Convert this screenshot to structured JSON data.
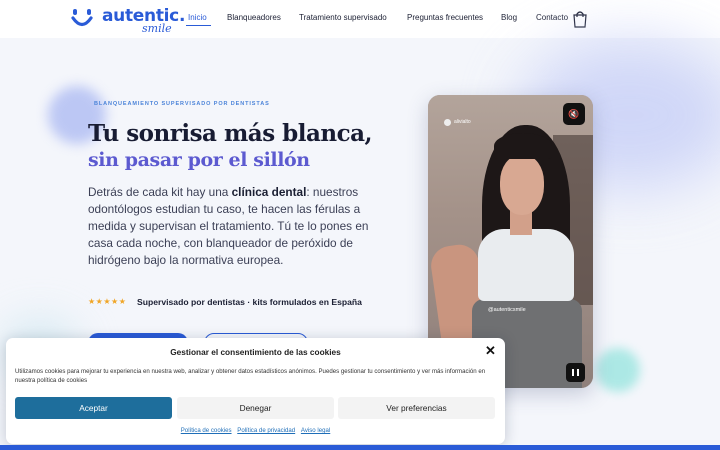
{
  "brand": {
    "name": "autentic.",
    "sub": "smile",
    "color": "#2a5bd7"
  },
  "nav": {
    "items": [
      "Inicio",
      "Blanqueadores",
      "Tratamiento supervisado",
      "Preguntas frecuentes",
      "Blog",
      "Contacto"
    ],
    "active": "Inicio",
    "cart_icon": "shopping-bag-icon"
  },
  "hero": {
    "eyebrow": "BLANQUEAMIENTO SUPERVISADO POR DENTISTAS",
    "title_line1": "Tu sonrisa más blanca,",
    "title_line2": "sin pasar por el sillón",
    "body_before": "Detrás de cada kit hay una ",
    "body_bold": "clínica dental",
    "body_after": ": nuestros odontólogos estudian tu caso, te hacen las férulas a medida y supervisan el tratamiento. Tú te lo pones en casa cada noche, con blanqueador de peróxido de hidrógeno bajo la normativa europea.",
    "stars": "★★★★★",
    "rating": 5,
    "trust_text": "Supervisado por dentistas · kits formulados en España"
  },
  "video": {
    "user": "alivialto",
    "tag": "@autenticsmile",
    "mute_icon": "speaker-muted-icon",
    "pause_icon": "pause-icon"
  },
  "cookie": {
    "title": "Gestionar el consentimiento de las cookies",
    "description": "Utilizamos cookies para mejorar tu experiencia en nuestra web, analizar y obtener datos estadísticos anónimos. Puedes gestionar tu consentimiento y ver más información en nuestra política de cookies",
    "accept": "Aceptar",
    "deny": "Denegar",
    "preferences": "Ver preferencias",
    "links": [
      "Política de cookies",
      "Política de privacidad",
      "Aviso legal"
    ],
    "close_icon": "close-icon",
    "accept_color": "#1e6e9c"
  }
}
